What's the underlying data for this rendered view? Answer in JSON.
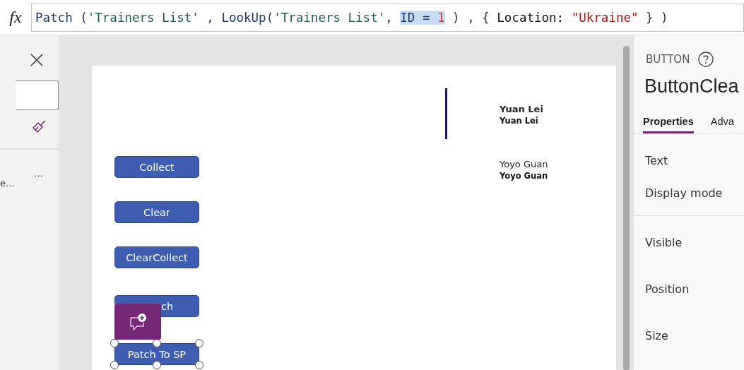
{
  "formula_bar": {
    "icon": "fx",
    "tokens": [
      {
        "kind": "func",
        "text": "Patch ("
      },
      {
        "kind": "string",
        "text": "'Trainers List'"
      },
      {
        "kind": "plain",
        "text": " , "
      },
      {
        "kind": "func",
        "text": "LookUp("
      },
      {
        "kind": "string",
        "text": "'Trainers List'"
      },
      {
        "kind": "plain",
        "text": ", "
      },
      {
        "kind": "highlight",
        "text": "ID = "
      },
      {
        "kind": "highlight-number",
        "text": "1"
      },
      {
        "kind": "plain",
        "text": " ) , { "
      },
      {
        "kind": "name",
        "text": "Location: "
      },
      {
        "kind": "literal",
        "text": "\"Ukraine\""
      },
      {
        "kind": "plain",
        "text": " } )"
      }
    ]
  },
  "left_panel": {
    "item_label": "e...",
    "item_more": "..."
  },
  "canvas": {
    "buttons": [
      {
        "label": "Collect",
        "selected": false
      },
      {
        "label": "Clear",
        "selected": false
      },
      {
        "label": "ClearCollect",
        "selected": false
      },
      {
        "label": "ch",
        "selected": false
      },
      {
        "label": "Patch To SP",
        "selected": true
      }
    ],
    "gallery": [
      {
        "title": "Yuan Lei",
        "subtitle": "Yuan Lei",
        "selected": true
      },
      {
        "title": "Yoyo Guan",
        "subtitle": "Yoyo Guan",
        "selected": false
      }
    ]
  },
  "properties_panel": {
    "type": "BUTTON",
    "name": "ButtonClea",
    "tabs": [
      {
        "label": "Properties",
        "selected": true
      },
      {
        "label": "Adva",
        "selected": false
      }
    ],
    "groups": [
      [
        "Text",
        "Display mode"
      ],
      [
        "Visible",
        "Position",
        "Size"
      ]
    ]
  }
}
